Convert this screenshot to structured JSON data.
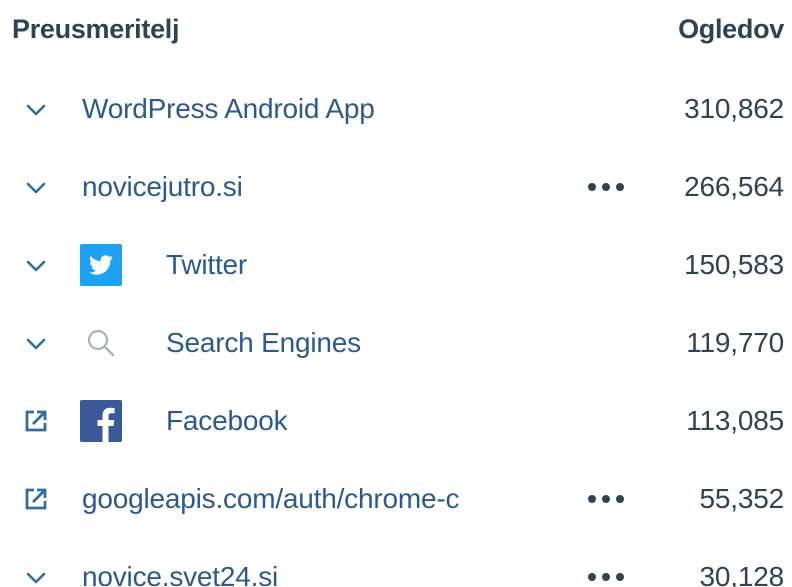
{
  "header": {
    "referrer_label": "Preusmeritelj",
    "views_label": "Ogledov"
  },
  "colors": {
    "link": "#2d5a8e",
    "text": "#2e4453",
    "icon": "#2f6ea3",
    "twitter": "#1da1f2",
    "facebook": "#3b5998"
  },
  "rows": [
    {
      "label": "WordPress Android App",
      "views": "310,862",
      "lead_icon": "chevron-down-icon",
      "badge": "none",
      "has_menu": false
    },
    {
      "label": "novicejutro.si",
      "views": "266,564",
      "lead_icon": "chevron-down-icon",
      "badge": "none",
      "has_menu": true
    },
    {
      "label": "Twitter",
      "views": "150,583",
      "lead_icon": "chevron-down-icon",
      "badge": "twitter-icon",
      "has_menu": false
    },
    {
      "label": "Search Engines",
      "views": "119,770",
      "lead_icon": "chevron-down-icon",
      "badge": "search-icon",
      "has_menu": false
    },
    {
      "label": "Facebook",
      "views": "113,085",
      "lead_icon": "external-link-icon",
      "badge": "facebook-icon",
      "has_menu": false
    },
    {
      "label": "googleapis.com/auth/chrome-c",
      "views": "55,352",
      "lead_icon": "external-link-icon",
      "badge": "none",
      "has_menu": true
    },
    {
      "label": "novice.svet24.si",
      "views": "30,128",
      "lead_icon": "chevron-down-icon",
      "badge": "none",
      "has_menu": true
    }
  ]
}
